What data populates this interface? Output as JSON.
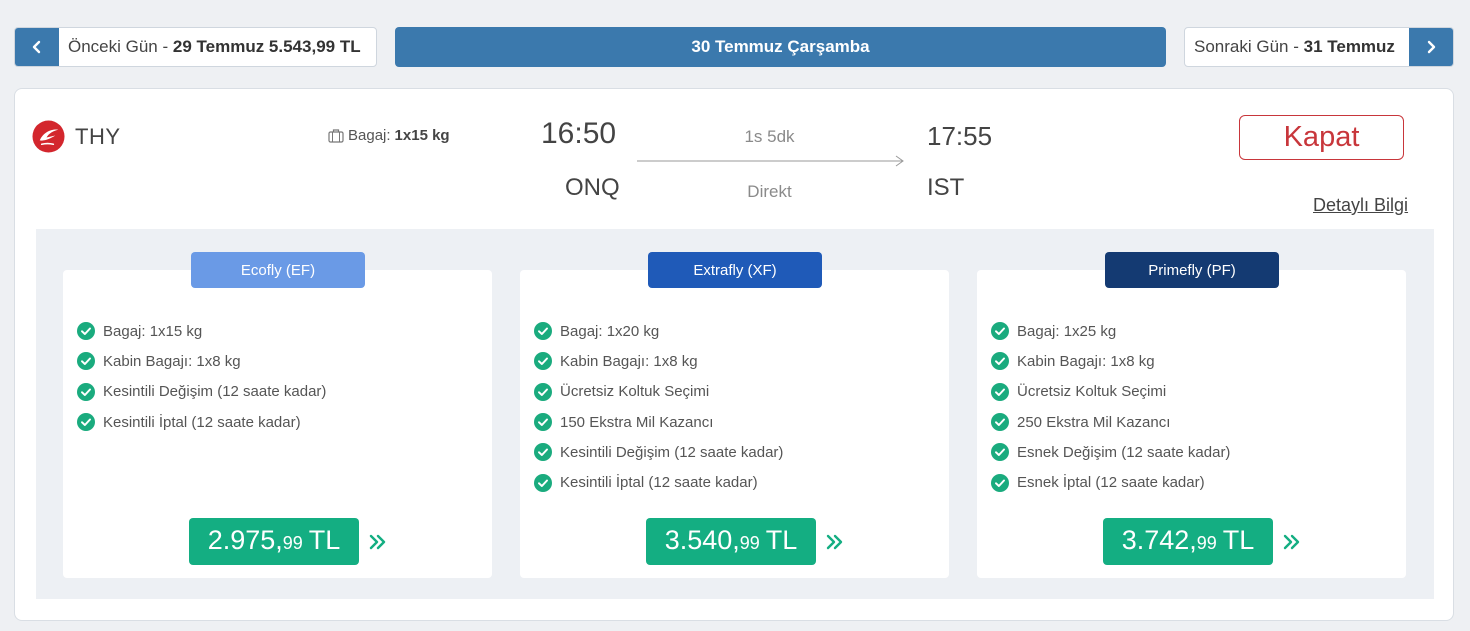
{
  "day_nav": {
    "prev_label": "Önceki Gün - ",
    "prev_date": "29 Temmuz 5.543,99 TL",
    "current_date": "30 Temmuz Çarşamba",
    "next_label": "Sonraki Gün - ",
    "next_date": "31 Temmuz"
  },
  "flight": {
    "airline": "THY",
    "baggage_label": "Bagaj:",
    "baggage_value": "1x15 kg",
    "departure_time": "16:50",
    "departure_code": "ONQ",
    "arrival_time": "17:55",
    "arrival_code": "IST",
    "duration": "1s 5dk",
    "stop_type": "Direkt",
    "close_label": "Kapat",
    "details_label": "Detaylı Bilgi"
  },
  "colors": {
    "primary": "#3b79ad",
    "close_red": "#c8363b",
    "price_green": "#14ae82",
    "check_green": "#1aab7e"
  },
  "fares": [
    {
      "name": "Ecofly (EF)",
      "badge_color": "#6a9ae6",
      "features": [
        "Bagaj: 1x15 kg",
        "Kabin Bagajı: 1x8 kg",
        "Kesintili Değişim (12 saate kadar)",
        "Kesintili İptal (12 saate kadar)"
      ],
      "price_main": "2.975,",
      "price_cents": "99",
      "currency": "TL"
    },
    {
      "name": "Extrafly (XF)",
      "badge_color": "#1f5ab8",
      "features": [
        "Bagaj: 1x20 kg",
        "Kabin Bagajı: 1x8 kg",
        "Ücretsiz Koltuk Seçimi",
        "150 Ekstra Mil Kazancı",
        "Kesintili Değişim (12 saate kadar)",
        "Kesintili İptal (12 saate kadar)"
      ],
      "price_main": "3.540,",
      "price_cents": "99",
      "currency": "TL"
    },
    {
      "name": "Primefly (PF)",
      "badge_color": "#143a72",
      "features": [
        "Bagaj: 1x25 kg",
        "Kabin Bagajı: 1x8 kg",
        "Ücretsiz Koltuk Seçimi",
        "250 Ekstra Mil Kazancı",
        "Esnek Değişim (12 saate kadar)",
        "Esnek İptal (12 saate kadar)"
      ],
      "price_main": "3.742,",
      "price_cents": "99",
      "currency": "TL"
    }
  ]
}
